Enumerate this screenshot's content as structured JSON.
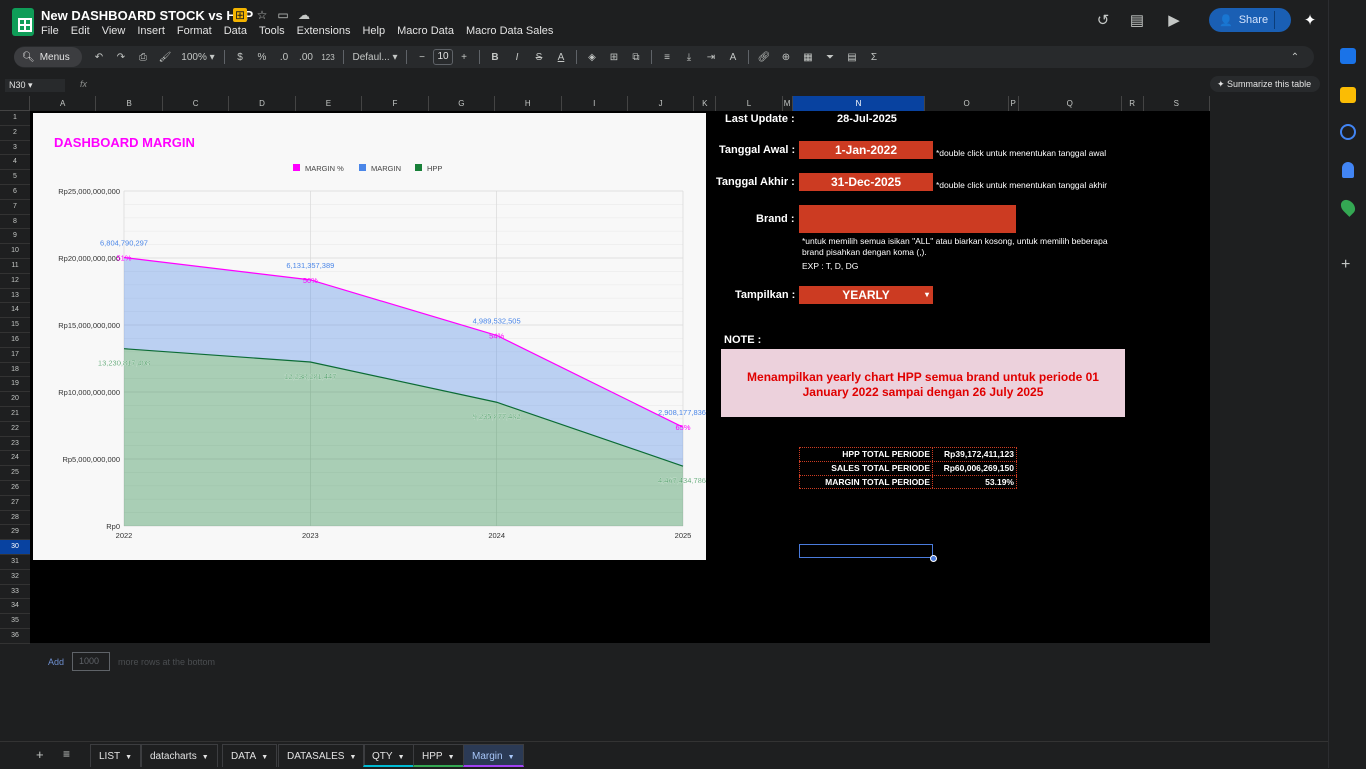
{
  "app": {
    "title": "New DASHBOARD STOCK vs HPP",
    "menu": [
      "File",
      "Edit",
      "View",
      "Insert",
      "Format",
      "Data",
      "Tools",
      "Extensions",
      "Help",
      "Macro Data",
      "Macro Data Sales"
    ],
    "share_label": "Share"
  },
  "toolbar": {
    "menus_label": "Menus",
    "zoom": "100%",
    "currency": "$",
    "percent": "%",
    "dec_less": ".0",
    "dec_more": ".00",
    "format_123": "123",
    "font": "Defaul...",
    "font_size": "10",
    "summarize": "Summarize this table"
  },
  "formula_bar": {
    "name_box": "N30",
    "fx": "fx"
  },
  "columns": [
    "A",
    "B",
    "C",
    "D",
    "E",
    "F",
    "G",
    "H",
    "I",
    "J",
    "K",
    "L",
    "M",
    "N",
    "O",
    "P",
    "Q",
    "R",
    "S"
  ],
  "selected_column": "N",
  "rows": [
    "1",
    "2",
    "3",
    "4",
    "5",
    "6",
    "7",
    "8",
    "9",
    "10",
    "11",
    "12",
    "13",
    "14",
    "15",
    "16",
    "17",
    "18",
    "19",
    "20",
    "21",
    "22",
    "23",
    "24",
    "25",
    "26",
    "27",
    "28",
    "29",
    "30",
    "31",
    "32",
    "33",
    "34",
    "35",
    "36"
  ],
  "selected_row": "30",
  "dashboard": {
    "last_update_label": "Last Update  :",
    "last_update_value": "28-Jul-2025",
    "tanggal_awal_label": "Tanggal Awal  :",
    "tanggal_awal_value": "1-Jan-2022",
    "tanggal_awal_hint": "*double click untuk menentukan tanggal awal",
    "tanggal_akhir_label": "Tanggal Akhir  :",
    "tanggal_akhir_value": "31-Dec-2025",
    "tanggal_akhir_hint": "*double click untuk menentukan tanggal akhir",
    "brand_label": "Brand  :",
    "brand_value": "",
    "brand_hint_1": "*untuk memilih semua isikan \"ALL\" atau biarkan kosong, untuk memilih beberapa",
    "brand_hint_2": "brand pisahkan dengan koma (,).",
    "brand_hint_3": "EXP : T, D, DG",
    "tampilkan_label": "Tampilkan  :",
    "tampilkan_value": "YEARLY",
    "note_label": "NOTE :",
    "note_text_1": "Menampilkan yearly chart HPP semua brand untuk periode 01",
    "note_text_2": "January 2022 sampai dengan 26 July 2025",
    "totals": [
      {
        "label": "HPP TOTAL PERIODE",
        "value": "Rp39,172,411,123"
      },
      {
        "label": "SALES TOTAL PERIODE",
        "value": "Rp60,006,269,150"
      },
      {
        "label": "MARGIN TOTAL PERIODE",
        "value": "53.19%"
      }
    ]
  },
  "add_rows": {
    "add_label": "Add",
    "count": "1000",
    "suffix": "more rows at the bottom"
  },
  "tabs": [
    "LIST",
    "datacharts",
    "DATA",
    "DATASALES",
    "QTY",
    "HPP",
    "Margin"
  ],
  "active_tab": "Margin",
  "colors": {
    "accent": "#cc3b22",
    "margin_pct": "#ff00ff",
    "margin": "#4a86e8",
    "hpp": "#188038",
    "note_bg": "#ecd1dc"
  },
  "chart_data": {
    "type": "area",
    "title": "DASHBOARD MARGIN",
    "x": [
      "2022",
      "2023",
      "2024",
      "2025"
    ],
    "ylim": [
      0,
      25000000000
    ],
    "yticks": [
      "Rp0",
      "Rp5,000,000,000",
      "Rp10,000,000,000",
      "Rp15,000,000,000",
      "Rp20,000,000,000",
      "Rp25,000,000,000"
    ],
    "legend_position": "top",
    "series": [
      {
        "name": "MARGIN %",
        "values": [
          51,
          50,
          54,
          65
        ],
        "labels": [
          "51%",
          "50%",
          "54%",
          "65%"
        ]
      },
      {
        "name": "MARGIN",
        "values": [
          6804790297,
          6131357389,
          4989532505,
          2908177836
        ],
        "labels": [
          "6,804,790,297",
          "6,131,357,389",
          "4,989,532,505",
          "2,908,177,836"
        ]
      },
      {
        "name": "HPP",
        "values": [
          13230817408,
          12238281447,
          9235877482,
          4467434786
        ],
        "labels": [
          "13,230,817,408",
          "12,238,281,447",
          "9,235,877,482",
          "4,467,434,786"
        ]
      }
    ]
  }
}
